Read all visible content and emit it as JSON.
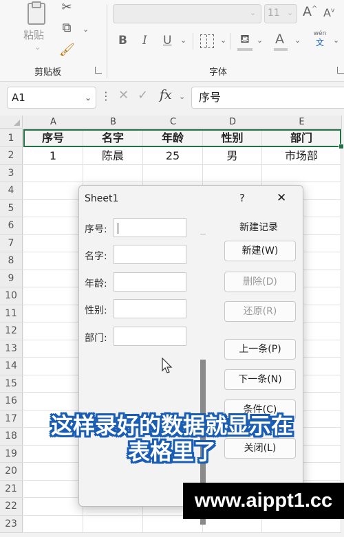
{
  "ribbon": {
    "clipboard": {
      "paste_label": "粘贴",
      "group_label": "剪贴板"
    },
    "font": {
      "size_value": "11",
      "group_label": "字体",
      "bold": "B",
      "italic": "I",
      "underline": "U",
      "font_color_glyph": "A",
      "phonetic_top": "wén",
      "phonetic_bottom": "文",
      "grow": "A",
      "shrink": "A"
    }
  },
  "formula_bar": {
    "name_box": "A1",
    "fx_label": "fx",
    "content": "序号"
  },
  "grid": {
    "columns": [
      "A",
      "B",
      "C",
      "D",
      "E"
    ],
    "rows": [
      "1",
      "2",
      "3",
      "4",
      "5",
      "6",
      "7",
      "8",
      "9",
      "10",
      "11",
      "12",
      "13",
      "14",
      "15",
      "16",
      "17",
      "18",
      "19",
      "20",
      "21",
      "22",
      "23"
    ],
    "header_row": [
      "序号",
      "名字",
      "年龄",
      "性别",
      "部门"
    ],
    "data_rows": [
      [
        "1",
        "陈晨",
        "25",
        "男",
        "市场部"
      ]
    ]
  },
  "dialog": {
    "title": "Sheet1",
    "help": "?",
    "close": "✕",
    "record_status": "新建记录",
    "fields": [
      {
        "label": "序号:",
        "value": ""
      },
      {
        "label": "名字:",
        "value": ""
      },
      {
        "label": "年龄:",
        "value": ""
      },
      {
        "label": "性别:",
        "value": ""
      },
      {
        "label": "部门:",
        "value": ""
      }
    ],
    "buttons": {
      "new": "新建(W)",
      "delete": "删除(D)",
      "restore": "还原(R)",
      "prev": "上一条(P)",
      "next": "下一条(N)",
      "criteria": "条件(C)",
      "close": "关闭(L)"
    }
  },
  "overlay": {
    "caption_line1": "这样录好的数据就显示在",
    "caption_line2": "表格里了",
    "watermark": "www.aippt1.cc"
  },
  "colors": {
    "caption_outline": "#1a5db4",
    "watermark_bg": "#000000",
    "selection_border": "#217346"
  }
}
